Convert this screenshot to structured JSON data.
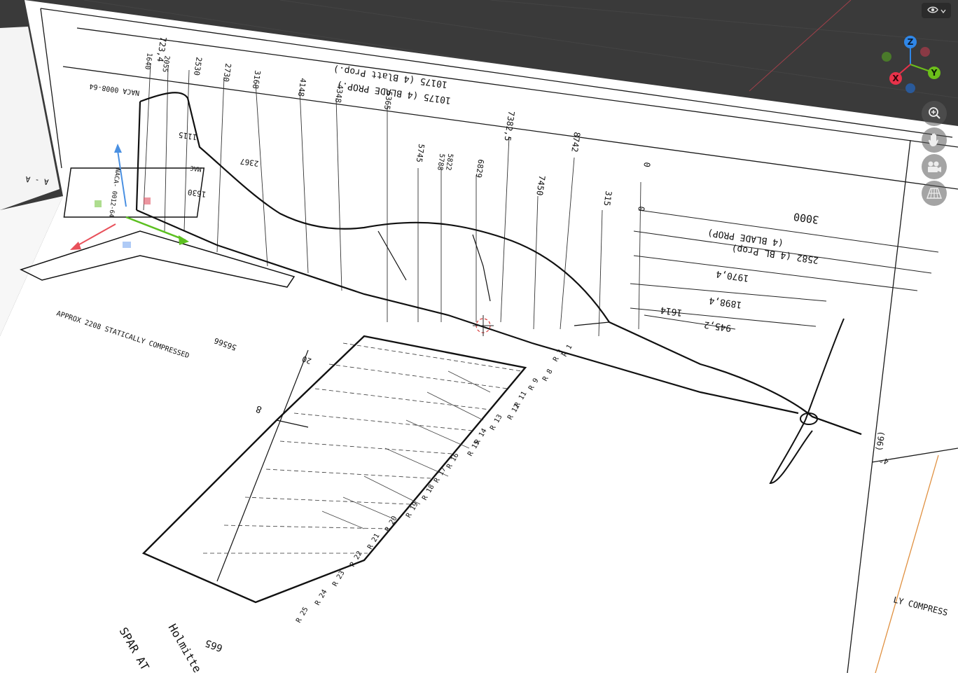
{
  "viewport": {
    "background_color": "#3a3a3a",
    "paper_color": "#ffffff",
    "line_color": "#1a1a1a"
  },
  "overlay": {
    "view_toggle_icon": "eye-icon",
    "zoom_icon": "zoom-in-icon",
    "pan_icon": "hand-icon",
    "camera_icon": "camera-icon",
    "grid_icon": "grid-perspective-icon"
  },
  "gizmo": {
    "z_label": "Z",
    "y_label": "Y",
    "x_label": "X",
    "z_color": "#2f87e8",
    "y_color": "#6cbf1a",
    "x_color": "#e8324a"
  },
  "blueprint": {
    "top_dims": [
      "10175 (4 Blatt Prop.)",
      "10175 (4 BLADE PROP.)"
    ],
    "vertical_dims": [
      "723,4",
      "1640",
      "2055",
      "2530",
      "2730",
      "3168",
      "4148",
      "4348",
      "5365",
      "5745",
      "5788",
      "5822",
      "6829",
      "7382,5",
      "7450",
      "8742",
      "315",
      "0",
      "0"
    ],
    "horizontal_dims": [
      "3000",
      "(4 BLADE PROP)",
      "2582 (4 BL Prop)",
      "1970,4",
      "1898,4",
      "1614",
      "945,2",
      "1115",
      "2367",
      "1630",
      "MAC"
    ],
    "left_labels": [
      "NACA 0008-64",
      "NACA- 0012-64",
      "A - A"
    ],
    "ribs": [
      "R 1",
      "R 3",
      "R 8",
      "R 9",
      "R 11",
      "R 12",
      "R 13",
      "R 14",
      "R 15",
      "R 16",
      "R 17",
      "R 18",
      "R 19",
      "R 20",
      "R 21",
      "R 22",
      "R 23",
      "R 24",
      "R 25"
    ],
    "bottom_labels": [
      "APPROX 2208 STATICALLY COMPRESSED",
      "56566",
      "665",
      "SPAR AT",
      "Holmitte",
      "20",
      "8",
      "LY COMPRESS"
    ],
    "misc": [
      "(96)",
      "4°"
    ]
  }
}
